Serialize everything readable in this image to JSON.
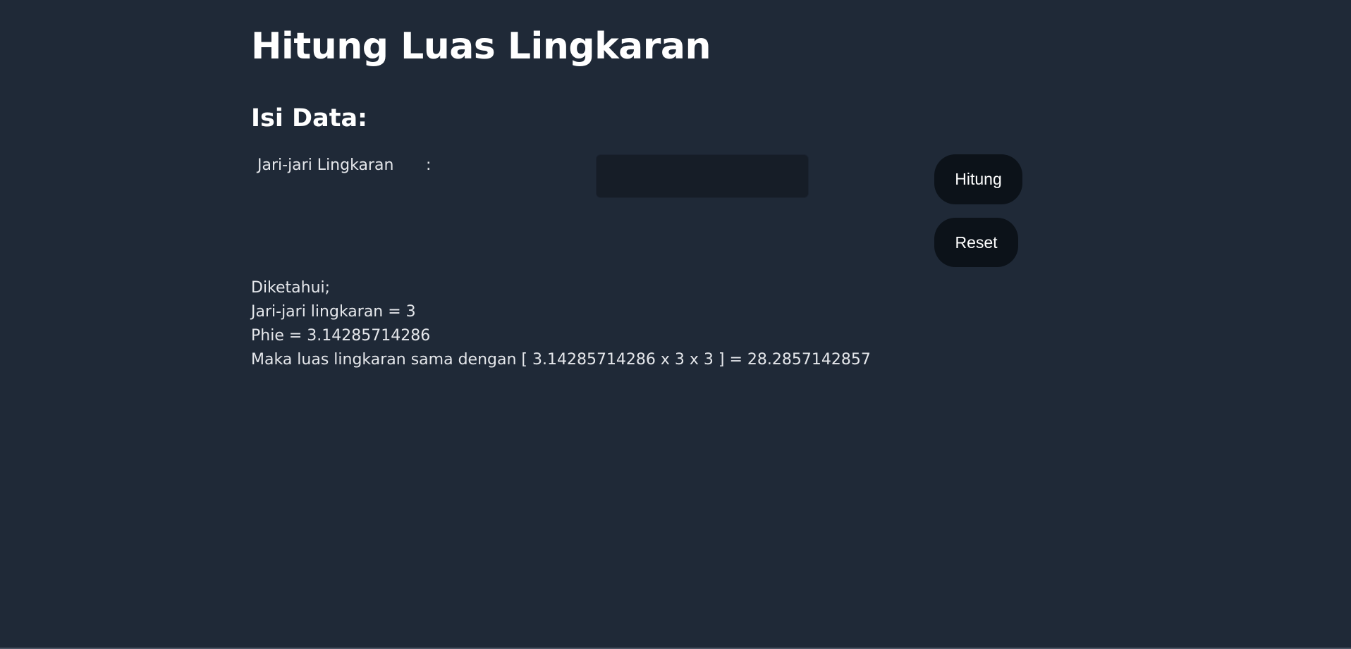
{
  "header": {
    "title": "Hitung Luas Lingkaran",
    "subtitle": "Isi Data:"
  },
  "form": {
    "radius_label": "Jari-jari Lingkaran",
    "colon": ":",
    "radius_value": "",
    "hitung_label": "Hitung",
    "reset_label": "Reset"
  },
  "result": {
    "line1": "Diketahui;",
    "line2": "Jari-jari lingkaran = 3",
    "line3": "Phie = 3.14285714286",
    "line4": "Maka luas lingkaran sama dengan [ 3.14285714286 x 3 x 3 ] = 28.2857142857"
  },
  "colors": {
    "background": "#1f2937",
    "input_background": "#161d27",
    "button_background": "#0c1219",
    "text": "#e5e7eb"
  }
}
